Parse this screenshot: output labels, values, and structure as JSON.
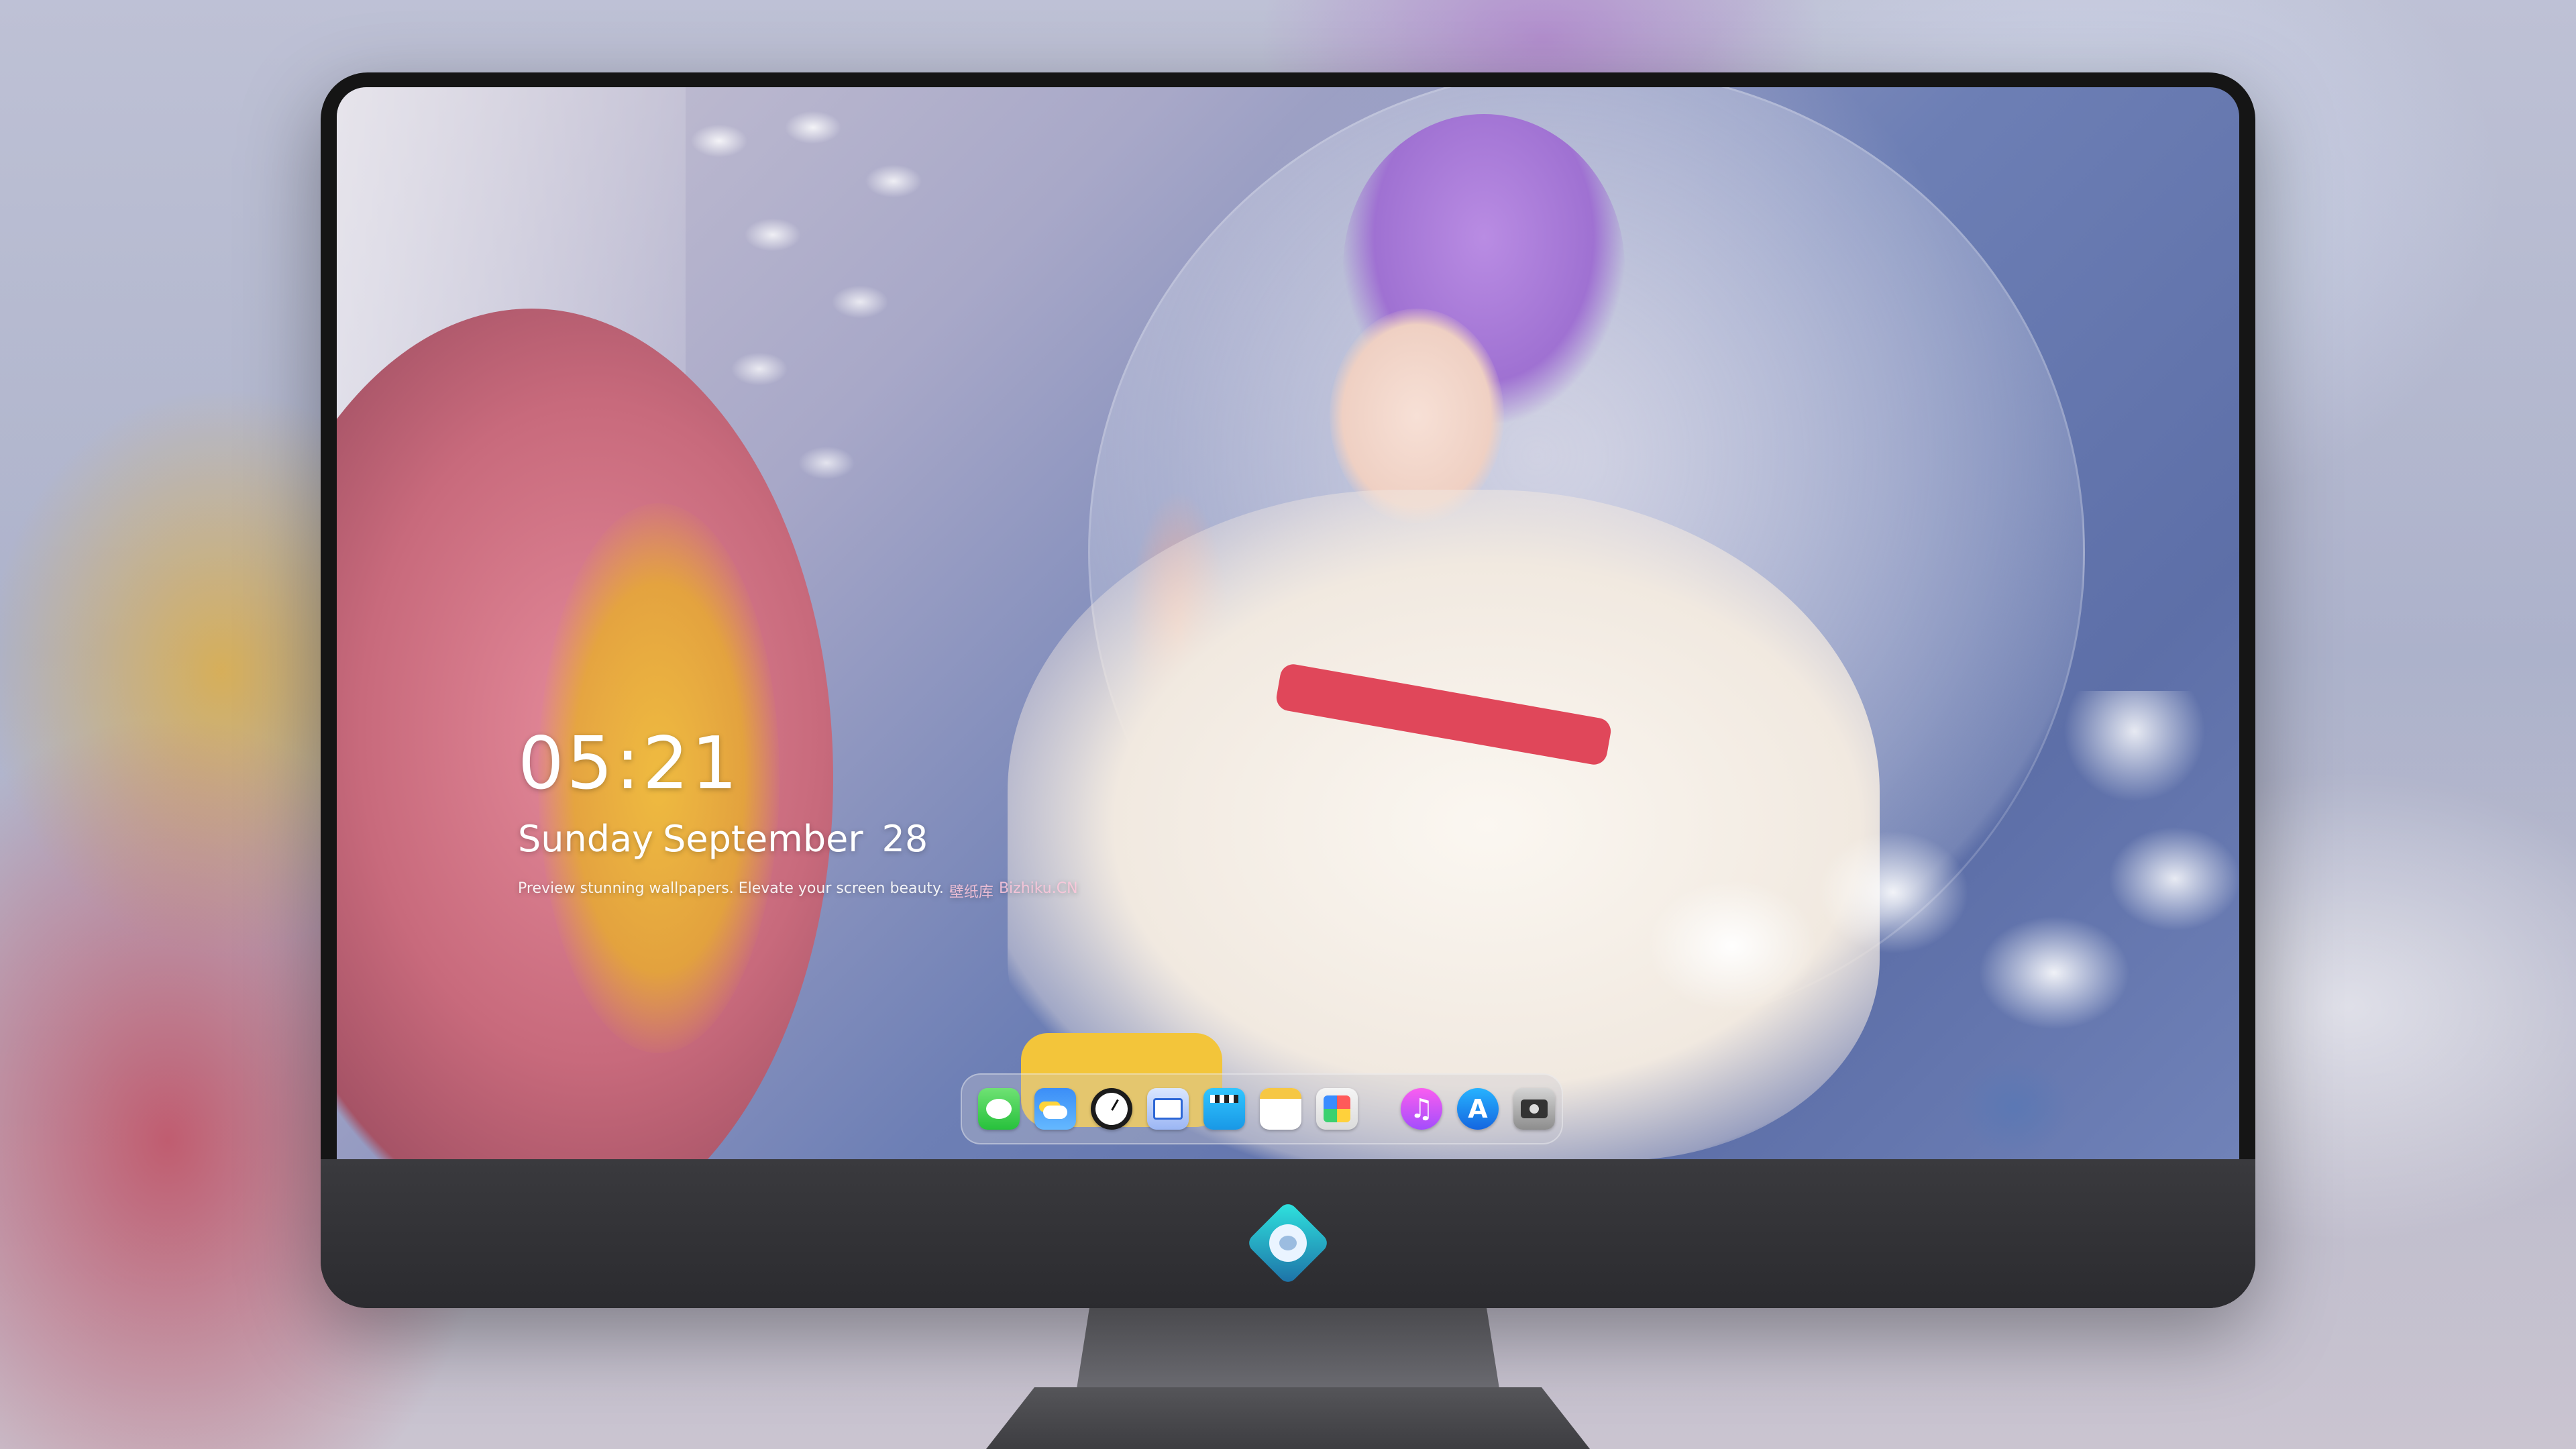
{
  "lock_screen": {
    "time": "05:21",
    "weekday": "Sunday",
    "month": "September",
    "day": "28",
    "tagline": "Preview stunning wallpapers. Elevate your screen beauty.",
    "tagline_cn": "壁纸库",
    "tagline_site": "Bizhiku.CN"
  },
  "dock": {
    "apps": [
      {
        "name": "messages-icon"
      },
      {
        "name": "weather-icon"
      },
      {
        "name": "clock-icon"
      },
      {
        "name": "preview-icon"
      },
      {
        "name": "clips-icon"
      },
      {
        "name": "notes-icon"
      },
      {
        "name": "photos-icon"
      },
      {
        "name": "music-icon"
      },
      {
        "name": "app-store-icon"
      },
      {
        "name": "camera-icon"
      }
    ]
  },
  "colors": {
    "monitor_frame": "#151515",
    "chin": "#333337",
    "logo_accent": "#2fe6e0"
  }
}
